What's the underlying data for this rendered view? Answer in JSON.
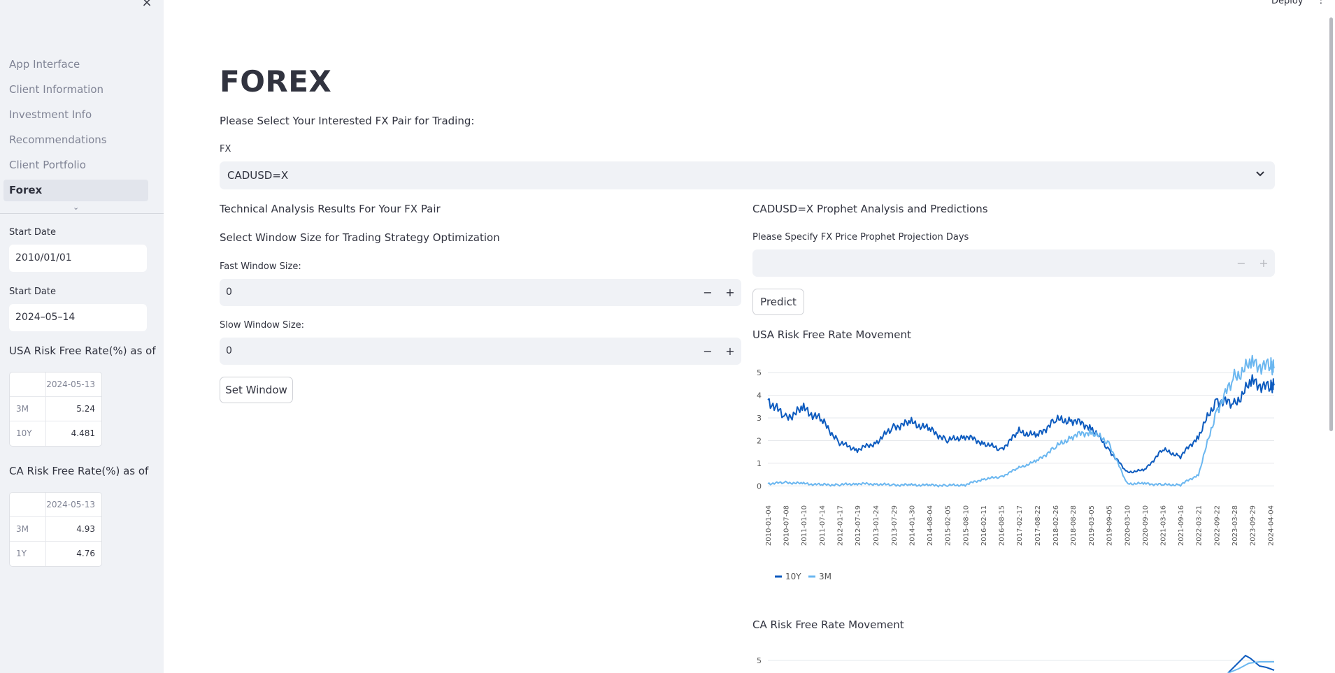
{
  "sidebar": {
    "close_icon": "×",
    "nav": [
      {
        "label": "App Interface"
      },
      {
        "label": "Client Information"
      },
      {
        "label": "Investment Info"
      },
      {
        "label": "Recommendations"
      },
      {
        "label": "Client Portfolio"
      },
      {
        "label": "Forex"
      }
    ],
    "active_nav": "Forex",
    "chevron_icon": "⌄",
    "start_date_label": "Start Date",
    "start_date_value": "2010/01/01",
    "end_date_label": "Start Date",
    "end_date_value": "2024–05–14",
    "usa_heading": "USA Risk Free Rate(%) as of",
    "usa_table": {
      "column": "2024-05-13",
      "rows": [
        {
          "index": "3M",
          "value": "5.24"
        },
        {
          "index": "10Y",
          "value": "4.481"
        }
      ]
    },
    "ca_heading": "CA Risk Free Rate(%) as of",
    "ca_table": {
      "column": "2024-05-13",
      "rows": [
        {
          "index": "3M",
          "value": "4.93"
        },
        {
          "index": "1Y",
          "value": "4.76"
        }
      ]
    }
  },
  "header": {
    "deploy_label": "Deploy",
    "menu_icon": "⋮"
  },
  "main": {
    "title": "FOREX",
    "prompt": "Please Select Your Interested FX Pair for Trading:",
    "fx_label": "FX",
    "fx_value": "CADUSD=X",
    "select_chevron": "⌄",
    "ta_heading": "Technical Analysis Results For Your FX Pair",
    "window_heading": "Select Window Size for Trading Strategy Optimization",
    "fast_label": "Fast Window Size:",
    "fast_value": "0",
    "slow_label": "Slow Window Size:",
    "slow_value": "0",
    "minus": "−",
    "plus": "+",
    "set_window_label": "Set Window",
    "prophet_heading": "CADUSD=X Prophet Analysis and Predictions",
    "prophet_days_label": "Please Specify FX Price Prophet Projection Days",
    "prophet_days_value": "",
    "predict_label": "Predict",
    "usa_chart_title": "USA Risk Free Rate Movement",
    "ca_chart_title": "CA Risk Free Rate Movement"
  },
  "chart_data": [
    {
      "type": "line",
      "title": "USA Risk Free Rate Movement",
      "xlabel": "",
      "ylabel": "",
      "ylim": [
        -0.3,
        5.5
      ],
      "yticks": [
        0,
        1,
        2,
        3,
        4,
        5
      ],
      "grid": true,
      "legend_position": "bottom-left",
      "x_tick_labels": [
        "2010-01-04",
        "2010-07-08",
        "2011-01-10",
        "2011-07-14",
        "2012-01-17",
        "2012-07-19",
        "2013-01-24",
        "2013-07-29",
        "2014-01-30",
        "2014-08-04",
        "2015-02-05",
        "2015-08-10",
        "2016-02-11",
        "2016-08-15",
        "2017-02-17",
        "2017-08-22",
        "2018-02-26",
        "2018-08-28",
        "2019-03-05",
        "2019-09-05",
        "2020-03-10",
        "2020-09-10",
        "2021-03-16",
        "2021-09-16",
        "2022-03-21",
        "2022-09-22",
        "2023-03-28",
        "2023-09-29",
        "2024-04-04"
      ],
      "x": [
        "2010-01-04",
        "2010-07-08",
        "2011-01-10",
        "2011-07-14",
        "2012-01-17",
        "2012-07-19",
        "2013-01-24",
        "2013-07-29",
        "2014-01-30",
        "2014-08-04",
        "2015-02-05",
        "2015-08-10",
        "2016-02-11",
        "2016-08-15",
        "2017-02-17",
        "2017-08-22",
        "2018-02-26",
        "2018-08-28",
        "2019-03-05",
        "2019-09-05",
        "2020-03-10",
        "2020-09-10",
        "2021-03-16",
        "2021-09-16",
        "2022-03-21",
        "2022-09-22",
        "2023-03-28",
        "2023-09-29",
        "2024-04-04",
        "2024-05-13"
      ],
      "series": [
        {
          "name": "10Y",
          "color": "#0d5bbf",
          "values": [
            3.8,
            3.0,
            3.4,
            2.9,
            1.9,
            1.6,
            1.9,
            2.6,
            2.8,
            2.5,
            2.0,
            2.2,
            1.9,
            1.6,
            2.4,
            2.2,
            2.9,
            2.9,
            2.6,
            1.6,
            0.6,
            0.7,
            1.6,
            1.3,
            2.2,
            3.8,
            3.6,
            4.6,
            4.3,
            4.5
          ]
        },
        {
          "name": "3M",
          "color": "#6bb7f0",
          "values": [
            0.1,
            0.15,
            0.1,
            0.05,
            0.05,
            0.1,
            0.08,
            0.04,
            0.04,
            0.03,
            0.02,
            0.05,
            0.3,
            0.4,
            0.8,
            1.1,
            1.7,
            2.2,
            2.4,
            1.9,
            0.1,
            0.1,
            0.05,
            0.05,
            0.5,
            3.3,
            4.8,
            5.4,
            5.25,
            5.24
          ]
        }
      ]
    },
    {
      "type": "line",
      "title": "CA Risk Free Rate Movement",
      "yticks": [
        5
      ],
      "grid": true,
      "series": []
    }
  ]
}
